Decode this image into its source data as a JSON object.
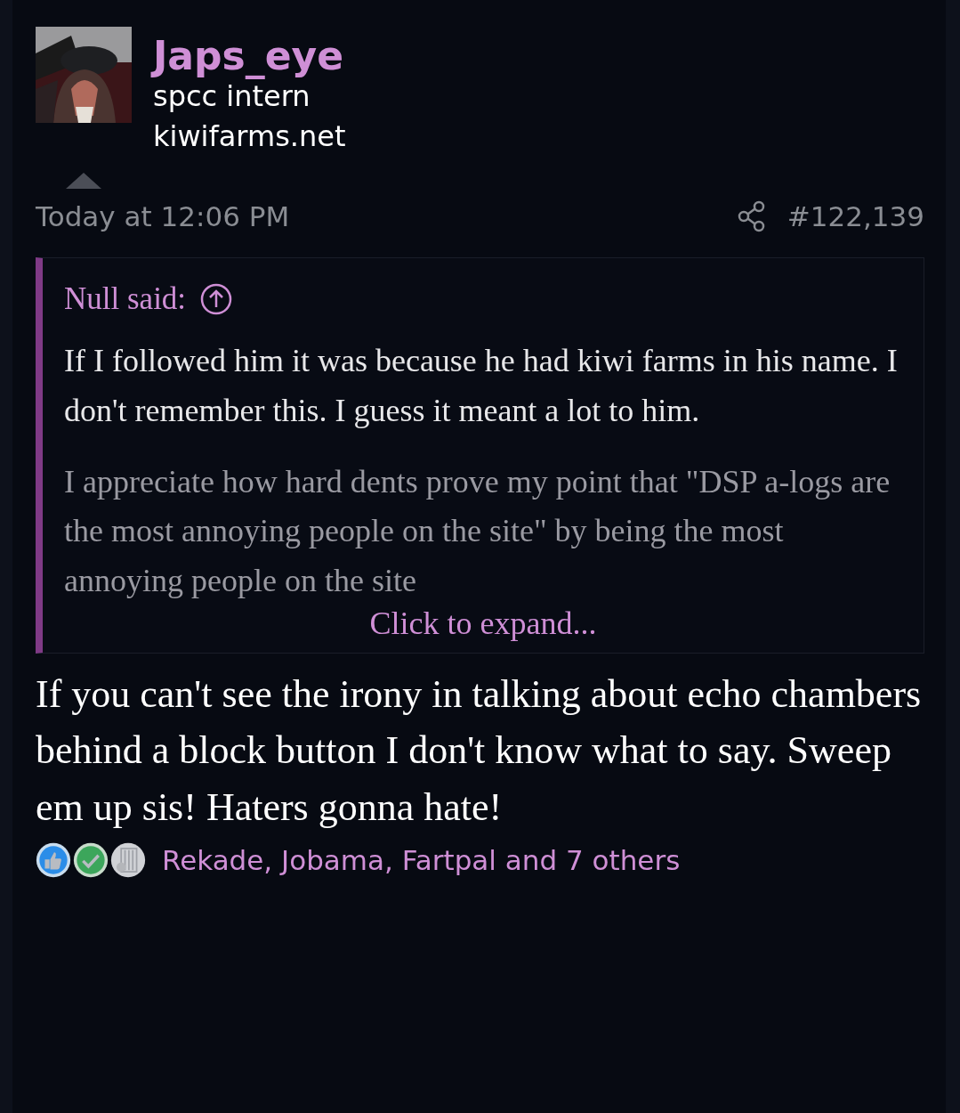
{
  "post": {
    "author": "Japs_eye",
    "user_title": "spcc intern",
    "user_banner": "kiwifarms.net",
    "date": "Today at 12:06 PM",
    "post_number": "#122,139",
    "quote": {
      "attribution": "Null said:",
      "paragraphs": [
        "If I followed him it was because he had kiwi farms in his name. I don't remember this. I guess it meant a lot to him.",
        "I appreciate how hard dents prove my point that \"DSP a-logs are the most annoying people on the site\" by being the most annoying people on the site"
      ],
      "expand_link": "Click to expand..."
    },
    "body": "If you can't see the irony in talking about echo chambers behind a block button I don't know what to say. Sweep em up sis! Haters gonna hate!",
    "reactions": [
      {
        "kind": "like"
      },
      {
        "kind": "agree"
      },
      {
        "kind": "jail"
      }
    ],
    "reaction_summary": "Rekade, Jobama, Fartpal and 7 others"
  }
}
